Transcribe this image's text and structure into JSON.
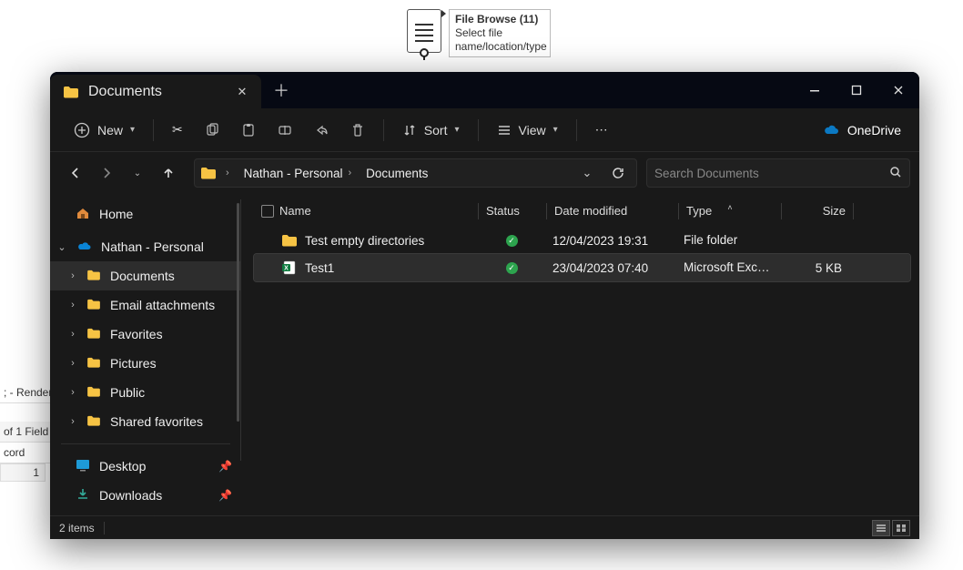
{
  "bg": {
    "tool_title": "File Browse (11)",
    "tool_sub": "Select file name/location/type",
    "left1": "; - Render",
    "left2": "of 1 Field",
    "left3": "cord",
    "left4": "1"
  },
  "tab": {
    "title": "Documents"
  },
  "toolbar": {
    "new": "New",
    "sort": "Sort",
    "view": "View",
    "onedrive": "OneDrive"
  },
  "breadcrumbs": {
    "root": "Nathan - Personal",
    "folder": "Documents"
  },
  "search": {
    "placeholder": "Search Documents"
  },
  "sidebar": {
    "home": "Home",
    "root": "Nathan - Personal",
    "items": [
      "Documents",
      "Email attachments",
      "Favorites",
      "Pictures",
      "Public",
      "Shared favorites"
    ],
    "desktop": "Desktop",
    "downloads": "Downloads"
  },
  "columns": {
    "name": "Name",
    "status": "Status",
    "date": "Date modified",
    "type": "Type",
    "size": "Size"
  },
  "files": [
    {
      "name": "Test empty directories",
      "kind": "folder",
      "date": "12/04/2023 19:31",
      "type": "File folder",
      "size": ""
    },
    {
      "name": "Test1",
      "kind": "excel",
      "date": "23/04/2023 07:40",
      "type": "Microsoft Excel W...",
      "size": "5 KB"
    }
  ],
  "statusbar": {
    "count": "2 items"
  }
}
